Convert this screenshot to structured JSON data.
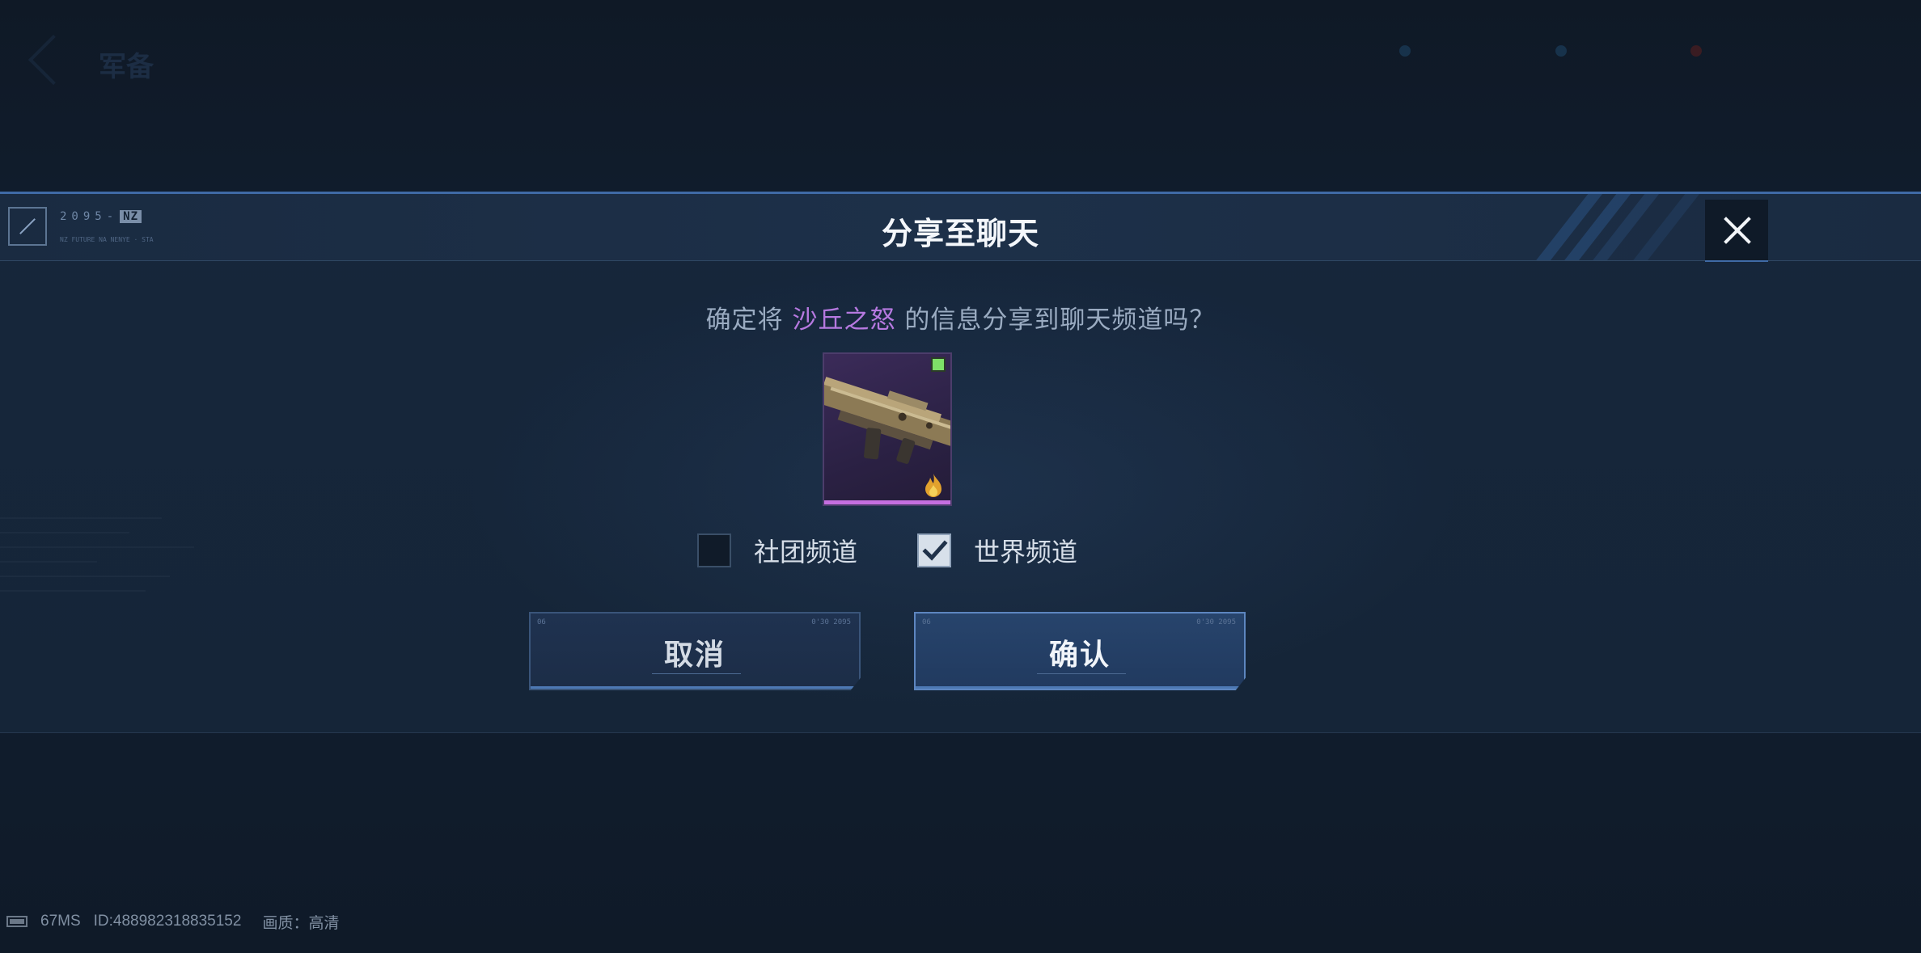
{
  "modal": {
    "title": "分享至聊天",
    "header_tag": "2095-",
    "header_tag_box": "NZ",
    "header_subtag": "NZ FUTURE NA NENYE · STA",
    "question_prefix": "确定将",
    "item_name": "沙丘之怒",
    "question_suffix": "的信息分享到聊天频道吗？",
    "item_icon": "rifle-icon",
    "item_rarity_color": "#c56fe0",
    "item_badge_color": "#7ee068",
    "channels": [
      {
        "label": "社团频道",
        "checked": false
      },
      {
        "label": "世界频道",
        "checked": true
      }
    ],
    "cancel_label": "取消",
    "confirm_label": "确认",
    "button_corner_left": "06",
    "button_corner_right": "0'30 2095"
  },
  "background": {
    "title": "军备"
  },
  "status": {
    "latency": "67MS",
    "id": "ID:488982318835152",
    "quality": "画质：高清"
  },
  "colors": {
    "accent": "#3f6aa6",
    "item_highlight": "#b679e0",
    "background": "#101a28"
  }
}
